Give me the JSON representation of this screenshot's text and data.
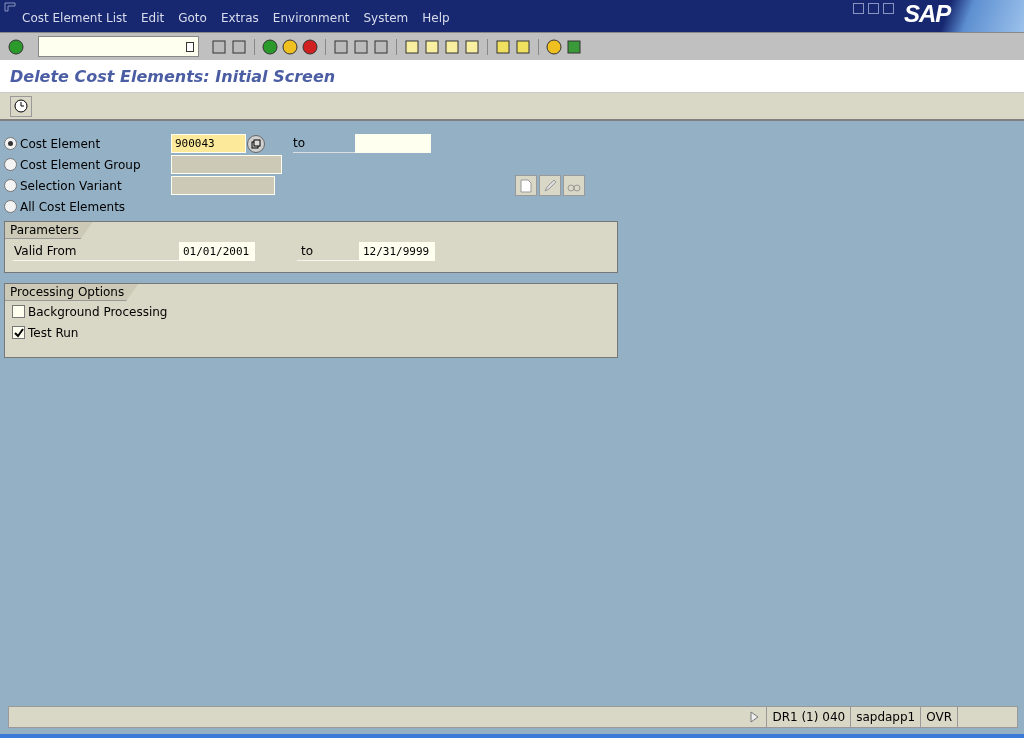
{
  "window": {
    "logo": "SAP"
  },
  "menu": [
    "Cost Element List",
    "Edit",
    "Goto",
    "Extras",
    "Environment",
    "System",
    "Help"
  ],
  "title": "Delete Cost Elements: Initial Screen",
  "selection": [
    {
      "label": "Cost Element",
      "selected": true,
      "kind": "range",
      "value": "900043",
      "to_label": "to"
    },
    {
      "label": "Cost Element Group",
      "selected": false,
      "kind": "group"
    },
    {
      "label": "Selection Variant",
      "selected": false,
      "kind": "variant"
    },
    {
      "label": "All Cost Elements",
      "selected": false,
      "kind": "none"
    }
  ],
  "parameters": {
    "title": "Parameters",
    "label": "Valid From",
    "from": "01/01/2001",
    "to_label": "to",
    "to": "12/31/9999"
  },
  "processing": {
    "title": "Processing Options",
    "options": [
      {
        "label": "Background Processing",
        "checked": false
      },
      {
        "label": "Test Run",
        "checked": true
      }
    ]
  },
  "status_bar": {
    "system": "DR1 (1) 040",
    "server": "sapdapp1",
    "mode": "OVR"
  }
}
